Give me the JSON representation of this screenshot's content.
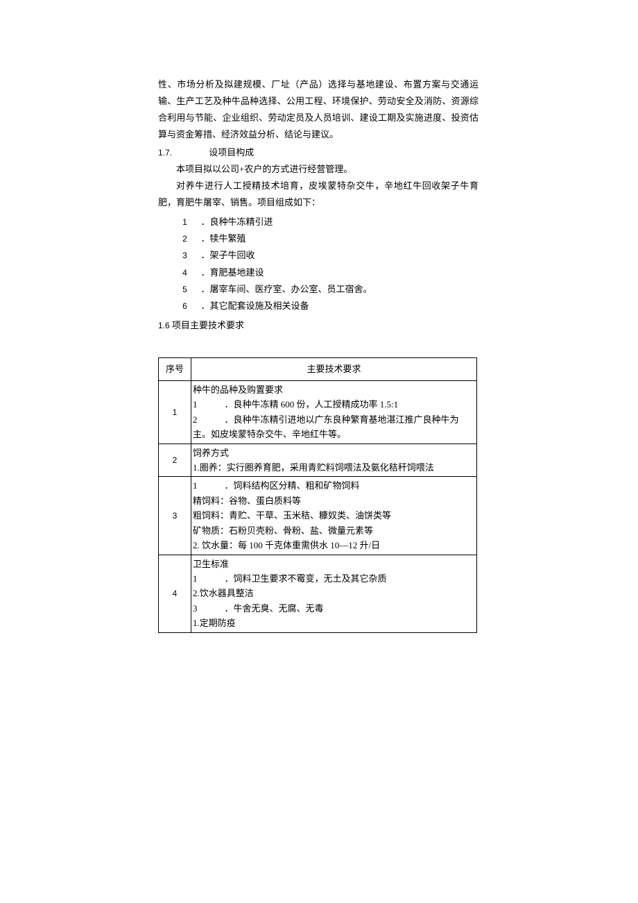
{
  "intro": {
    "paragraph": "性、市场分析及拟建规模、厂址（产品）选择与基地建设、布置方案与交通运输、生产工艺及种牛品种选择、公用工程、环境保护、劳动安全及消防、资源综合利用与节能、企业组织、劳动定员及人员培训、建设工期及实施进度、投资估算与资金筹措、经济效益分析、结论与建议。"
  },
  "section17": {
    "number": "1.7.",
    "title": "设项目构成",
    "p1": "本项目拟以公司+农户的方式进行经营管理。",
    "p2": "对养牛进行人工授精技术培育，皮埃蒙特杂交牛，辛地红牛回收架子牛育肥，育肥牛屠宰、销售。项目组成如下：",
    "items": [
      {
        "n": "1",
        "t": "．良种牛冻精引进"
      },
      {
        "n": "2",
        "t": "．犊牛繁殖"
      },
      {
        "n": "3",
        "t": "．架子牛回收"
      },
      {
        "n": "4",
        "t": "．育肥基地建设"
      },
      {
        "n": "5",
        "t": "．屠宰车间、医疗室、办公室、员工宿舍。"
      },
      {
        "n": "6",
        "t": "．其它配套设施及相关设备"
      }
    ]
  },
  "section16": {
    "number": "1.6",
    "title": "项目主要技术要求"
  },
  "table": {
    "head": {
      "c1": "序号",
      "c2": "主要技术要求"
    },
    "rows": [
      {
        "seq": "1",
        "lines": [
          "种牛的品种及购置要求",
          "1            ．良种牛冻精 600 份，人工授精成功率 1.5:1",
          "2            ．良种牛冻精引进地以广东良种繁育基地湛江推广良种牛为主。如皮埃蒙特杂交牛、辛地红牛等。"
        ]
      },
      {
        "seq": "2",
        "lines": [
          "饲养方式",
          "1.圈养：实行圈养育肥，采用青贮料饲喂法及氨化秸秆饲喂法"
        ]
      },
      {
        "seq": "3",
        "lines": [
          "1            ．饲料结构区分精、粗和矿物饲料",
          "精饲料：谷物、蛋白质料等",
          "粗饲料：青贮、干草、玉米秸、糠奴类、油饼类等",
          "矿物质：石粉贝壳粉、骨粉、盐、微量元素等",
          "2. 饮水量：每 100 千克体重需供水 10—12 升/日"
        ]
      },
      {
        "seq": "4",
        "lines": [
          "卫生标准",
          "1            ．饲料卫生要求不霉变，无土及其它杂质",
          "2.饮水器具整洁",
          "3            ．牛舍无臭、无腐、无毒",
          "1.定期防疫"
        ]
      }
    ]
  }
}
